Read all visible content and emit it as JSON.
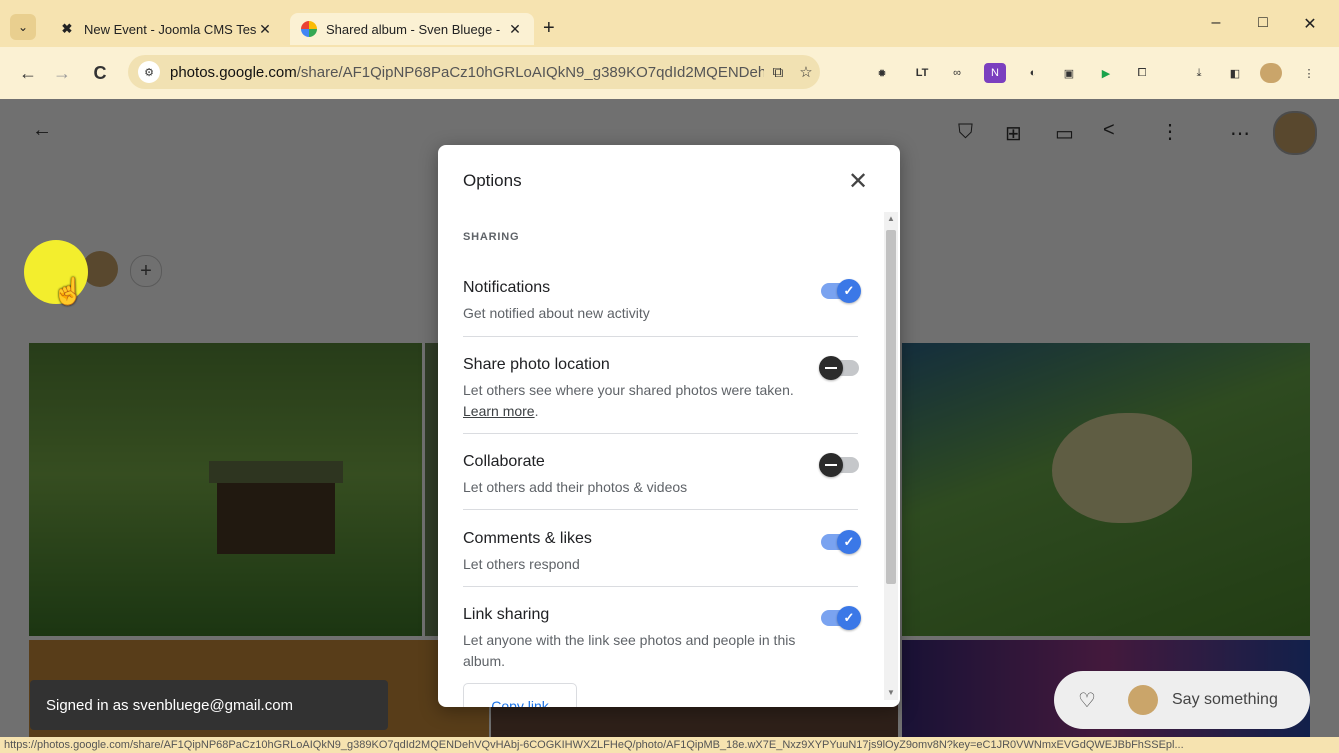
{
  "browser": {
    "tabs": [
      {
        "title": "New Event - Joomla CMS Test",
        "favicon": "joomla-icon"
      },
      {
        "title": "Shared album - Sven Bluege -",
        "favicon": "google-photos-icon",
        "active": true
      }
    ],
    "new_tab_label": "+",
    "url_domain": "photos.google.com",
    "url_path": "/share/AF1QipNP68PaCz10hGRLoAIQkN9_g389KO7qdId2MQENDehVQvH...",
    "window_controls": {
      "minimize": "–",
      "maximize": "□",
      "close": "✕"
    },
    "extensions": [
      "extension-icon-1",
      "extension-icon-2",
      "extension-icon-3",
      "extension-icon-4",
      "extension-icon-5",
      "extension-icon-6",
      "extension-icon-7",
      "extension-icon-8"
    ]
  },
  "dialog": {
    "title": "Options",
    "section_label": "SHARING",
    "options": [
      {
        "title": "Notifications",
        "desc": "Get notified about new activity",
        "enabled": true
      },
      {
        "title": "Share photo location",
        "desc": "Let others see where your shared photos were taken.",
        "link": "Learn more",
        "enabled": false
      },
      {
        "title": "Collaborate",
        "desc": "Let others add their photos & videos",
        "enabled": false
      },
      {
        "title": "Comments & likes",
        "desc": "Let others respond",
        "enabled": true
      },
      {
        "title": "Link sharing",
        "desc": "Let anyone with the link see photos and people in this album.",
        "enabled": true
      }
    ],
    "copy_link_label": "Copy link"
  },
  "snackbar": {
    "text": "Signed in as svenbluege@gmail.com"
  },
  "comment_bar": {
    "placeholder": "Say something"
  },
  "statusbar": {
    "url": "https://photos.google.com/share/AF1QipNP68PaCz10hGRLoAIQkN9_g389KO7qdId2MQENDehVQvHAbj-6COGKIHWXZLFHeQ/photo/AF1QipMB_18e.wX7E_Nxz9XYPYuuN17js9lOyZ9omv8N?key=eC1JR0VWNmxEVGdQWEJBbFhSSEpl..."
  },
  "colors": {
    "toggle_on": "#3b78e7",
    "toggle_off": "#2b2b2b",
    "link": "#1a73e8",
    "titlebar": "#f6e3b0"
  }
}
